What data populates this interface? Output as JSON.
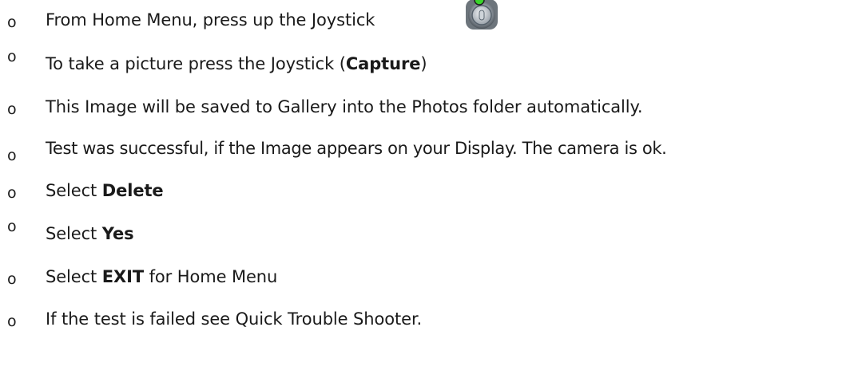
{
  "bullets": {
    "symbol": "o"
  },
  "items": [
    {
      "text": "From Home Menu, press up the Joystick"
    },
    {
      "before": "To take a picture press the Joystick (",
      "bold": "Capture",
      "after": ")"
    },
    {
      "text": "This Image will be saved to Gallery into the Photos folder automatically."
    },
    {
      "text": "Test was successful, if the Image appears on your Display. The camera is ok."
    },
    {
      "before": "Select ",
      "bold": "Delete"
    },
    {
      "before": "Select ",
      "bold": "Yes"
    },
    {
      "before": "Select ",
      "bold": "EXIT",
      "after": " for Home Menu"
    },
    {
      "text": "If the test is failed see Quick Trouble Shooter."
    }
  ],
  "icons": {
    "joystick": "joystick-up-icon"
  }
}
